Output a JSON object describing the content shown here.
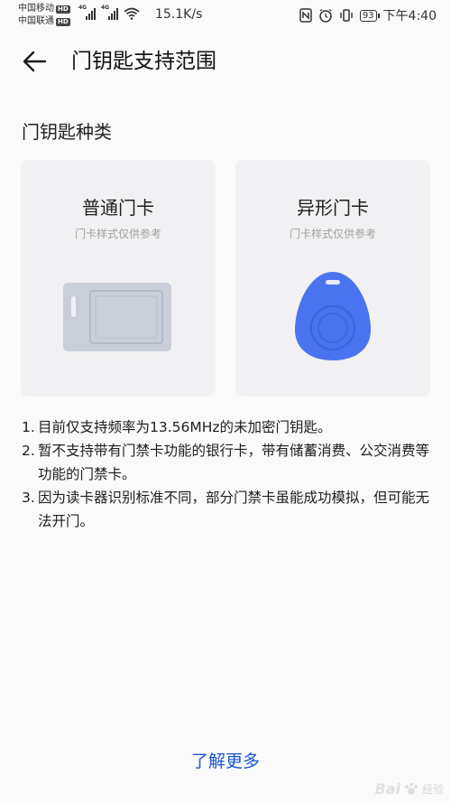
{
  "status_bar": {
    "carrier1": "中国移动",
    "carrier2": "中国联通",
    "hd": "HD",
    "network": "4G",
    "net_speed": "15.1K/s",
    "battery": "93",
    "time": "下午4:40"
  },
  "appbar": {
    "back_icon": "arrow-left-icon",
    "title": "门钥匙支持范围"
  },
  "section": {
    "title": "门钥匙种类"
  },
  "cards": [
    {
      "title": "普通门卡",
      "subtitle": "门卡样式仅供参考",
      "illustration": "access-card-icon"
    },
    {
      "title": "异形门卡",
      "subtitle": "门卡样式仅供参考",
      "illustration": "key-fob-icon"
    }
  ],
  "notes": [
    {
      "num": "1.",
      "text": "目前仅支持频率为13.56MHz的未加密门钥匙。"
    },
    {
      "num": "2.",
      "text": "暂不支持带有门禁卡功能的银行卡，带有储蓄消费、公交消费等功能的门禁卡。"
    },
    {
      "num": "3.",
      "text": "因为读卡器识别标准不同，部分门禁卡虽能成功模拟，但可能无法开门。"
    }
  ],
  "learn_more": "了解更多",
  "watermark": {
    "text": "Bai",
    "sub": "经验"
  },
  "colors": {
    "accent": "#1a56d6",
    "card_bg": "#f1f1f3",
    "fob": "#4a74ef",
    "card_gray": "#c9ced8"
  }
}
